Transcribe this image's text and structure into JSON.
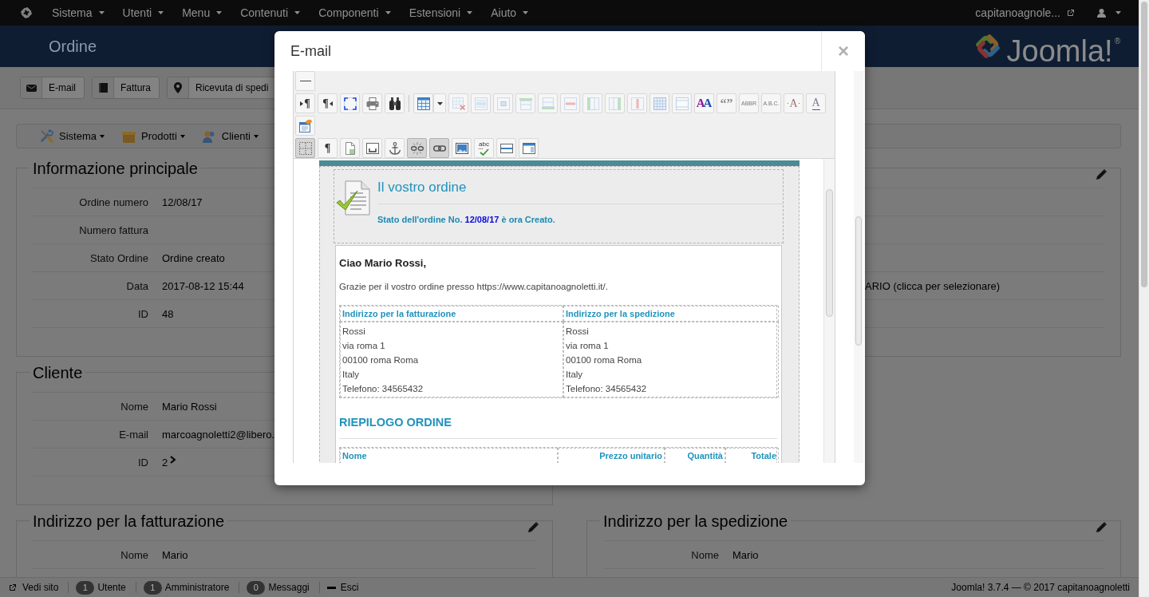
{
  "navbar": {
    "menus": [
      {
        "label": "Sistema"
      },
      {
        "label": "Utenti"
      },
      {
        "label": "Menu"
      },
      {
        "label": "Contenuti"
      },
      {
        "label": "Componenti"
      },
      {
        "label": "Estensioni"
      },
      {
        "label": "Aiuto"
      }
    ],
    "site_link": "capitanoagnole..."
  },
  "header": {
    "title": "Ordine",
    "brand": "Joomla!$^{®}$"
  },
  "actions": [
    {
      "kind": "email",
      "label": "E-mail"
    },
    {
      "kind": "invoice",
      "label": "Fattura"
    },
    {
      "kind": "shipping",
      "label": "Ricevuta di spedi"
    }
  ],
  "component_menu": [
    {
      "kind": "system",
      "label": "Sistema"
    },
    {
      "kind": "products",
      "label": "Prodotti"
    },
    {
      "kind": "customers",
      "label": "Clienti"
    }
  ],
  "sections": [
    [
      {
        "title": "Informazione principale",
        "rows": [
          {
            "kind": "text",
            "label": "Ordine numero",
            "value": "12/08/17"
          },
          {
            "kind": "text",
            "label": "Numero fattura"
          },
          {
            "kind": "text",
            "label": "Stato Ordine",
            "value": "Ordine creato"
          },
          {
            "kind": "text",
            "label": "Data",
            "value": "2017-08-12 15:44"
          },
          {
            "kind": "text",
            "label": "ID",
            "value": "48"
          }
        ]
      },
      {
        "edit_icon": true,
        "rows": [
          {
            "kind": "covered"
          },
          {
            "kind": "covered"
          },
          {
            "kind": "covered"
          },
          {
            "kind": "text",
            "value": "ARIO (clicca per selezionare)",
            "clipped_start": true
          },
          {
            "kind": "covered"
          }
        ]
      }
    ],
    [
      {
        "title": "Cliente",
        "rows": [
          {
            "kind": "text",
            "label": "Nome",
            "value": "Mario Rossi"
          },
          {
            "kind": "text",
            "label": "E-mail",
            "value": "marcoagnoletti2@libero."
          },
          {
            "kind": "link",
            "label": "ID",
            "value": "2"
          }
        ]
      }
    ],
    [
      {
        "title": "Indirizzo per la fatturazione",
        "edit_icon": true,
        "rows": [
          {
            "kind": "text",
            "label": "Nome",
            "value": "Mario"
          }
        ]
      },
      {
        "title": "Indirizzo per la spedizione",
        "edit_icon": true,
        "rows": [
          {
            "kind": "text",
            "label": "Nome",
            "value": "Mario"
          }
        ]
      }
    ]
  ],
  "modal": {
    "title": "E-mail",
    "close": "×",
    "toolbar_rows": [
      [
        [
          {
            "kind": "hr",
            "pressed": false,
            "disabled": false
          }
        ]
      ],
      [
        [
          {
            "kind": "ltr",
            "glyph": "¶",
            "pressed": false,
            "disabled": false
          },
          {
            "kind": "rtl",
            "glyph": "¶",
            "pressed": false,
            "disabled": false
          },
          {
            "kind": "fullscreen",
            "pressed": false,
            "disabled": false
          },
          {
            "kind": "print",
            "pressed": false,
            "disabled": false
          },
          {
            "kind": "find",
            "pressed": false,
            "disabled": false
          }
        ],
        [
          {
            "kind": "table",
            "pressed": false,
            "disabled": false
          },
          {
            "kind": "table_menu",
            "pressed": false,
            "disabled": false
          },
          {
            "kind": "delete_table",
            "pressed": false,
            "disabled": true
          },
          {
            "kind": "row_props",
            "pressed": false,
            "disabled": true
          },
          {
            "kind": "cell_props",
            "pressed": false,
            "disabled": true
          },
          {
            "kind": "row_before",
            "pressed": false,
            "disabled": true
          },
          {
            "kind": "row_after",
            "pressed": false,
            "disabled": true
          },
          {
            "kind": "delete_row",
            "pressed": false,
            "disabled": true
          },
          {
            "kind": "col_before",
            "pressed": false,
            "disabled": true
          },
          {
            "kind": "col_after",
            "pressed": false,
            "disabled": true
          },
          {
            "kind": "delete_col",
            "pressed": false,
            "disabled": true
          },
          {
            "kind": "split_cells",
            "pressed": false,
            "disabled": true
          },
          {
            "kind": "merge_cells",
            "pressed": false,
            "disabled": true
          },
          {
            "kind": "styles",
            "glyph": "AA",
            "pressed": false,
            "disabled": false
          },
          {
            "kind": "quote",
            "glyph": "“”",
            "pressed": false,
            "disabled": false
          },
          {
            "kind": "abbr",
            "glyph": "ABBR",
            "pressed": false,
            "disabled": false
          },
          {
            "kind": "acronym",
            "glyph": "A.B.C.",
            "pressed": false,
            "disabled": false
          },
          {
            "kind": "del",
            "glyph": "A",
            "pressed": false,
            "disabled": false
          },
          {
            "kind": "ins",
            "glyph": "A",
            "pressed": false,
            "disabled": false
          }
        ]
      ],
      [
        [
          {
            "kind": "template",
            "pressed": false,
            "disabled": false
          }
        ]
      ],
      [
        [
          {
            "kind": "visual_aid",
            "pressed": true,
            "disabled": false
          },
          {
            "kind": "show_blocks",
            "glyph": "¶",
            "pressed": false,
            "disabled": false
          },
          {
            "kind": "preview",
            "pressed": false,
            "disabled": false
          },
          {
            "kind": "frame",
            "pressed": false,
            "disabled": false
          },
          {
            "kind": "anchor",
            "pressed": false,
            "disabled": false
          },
          {
            "kind": "unlink",
            "pressed": true,
            "disabled": false
          },
          {
            "kind": "link",
            "pressed": true,
            "disabled": false
          },
          {
            "kind": "image",
            "pressed": false,
            "disabled": false
          },
          {
            "kind": "spellcheck",
            "glyph": "abc",
            "pressed": false,
            "disabled": false
          },
          {
            "kind": "hsplit",
            "pressed": false,
            "disabled": false
          },
          {
            "kind": "layer",
            "pressed": false,
            "disabled": false
          }
        ]
      ]
    ],
    "email": {
      "title": "Il vostro ordine",
      "status": {
        "before": "Stato dell'ordine No.",
        "order_number": "12/08/17",
        "after": "è ora Creato."
      },
      "greeting": "Ciao Mario Rossi,",
      "intro": "Grazie per il vostro ordine presso https://www.capitanoagnoletti.it/.",
      "addresses": [
        {
          "title": "Indirizzo per la fatturazione",
          "lines": [
            "Rossi",
            "via roma 1",
            "00100 roma Roma",
            "Italy",
            "Telefono: 34565432"
          ]
        },
        {
          "title": "Indirizzo per la spedizione",
          "lines": [
            "Rossi",
            "via roma 1",
            "00100 roma Roma",
            "Italy",
            "Telefono: 34565432"
          ]
        }
      ],
      "summary_title": "RIEPILOGO ORDINE",
      "item_columns": [
        "Nome",
        "Prezzo unitario",
        "Quantità",
        "Totale"
      ]
    }
  },
  "status_bar": {
    "items": [
      {
        "kind": "site",
        "label": "Vedi sito"
      },
      {
        "kind": "count",
        "count": "1",
        "label": "Utente"
      },
      {
        "kind": "count",
        "count": "1",
        "label": "Amministratore"
      },
      {
        "kind": "count",
        "count": "0",
        "label": "Messaggi"
      },
      {
        "kind": "logout",
        "label": "Esci"
      }
    ],
    "footer": "Joomla! 3.7.4 — © 2017 capitanoagnoletti"
  }
}
